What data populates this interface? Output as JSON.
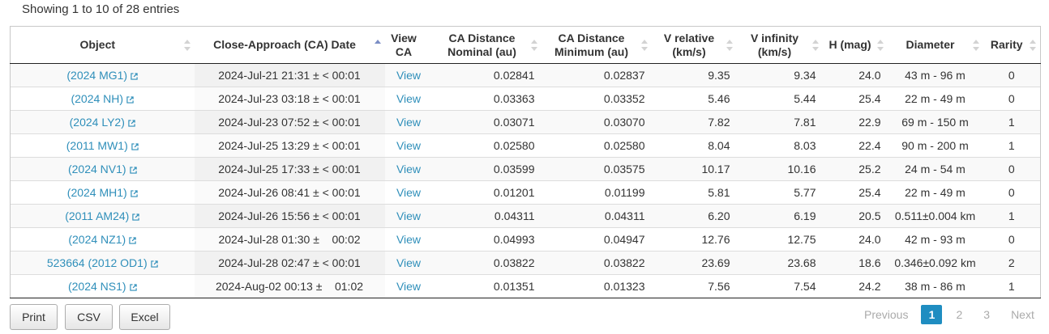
{
  "table_info": "Showing 1 to 10 of 28 entries",
  "columns": [
    {
      "label": "Object",
      "sort": "both"
    },
    {
      "label": "Close-Approach (CA) Date",
      "sort": "asc"
    },
    {
      "label": "View CA",
      "sort": "none"
    },
    {
      "label": "CA Distance Nominal (au)",
      "sort": "both"
    },
    {
      "label": "CA Distance Minimum (au)",
      "sort": "both"
    },
    {
      "label": "V relative (km/s)",
      "sort": "both"
    },
    {
      "label": "V infinity (km/s)",
      "sort": "both"
    },
    {
      "label": "H (mag)",
      "sort": "both"
    },
    {
      "label": "Diameter",
      "sort": "both"
    },
    {
      "label": "Rarity",
      "sort": "both"
    }
  ],
  "rows": [
    {
      "object": "(2024 MG1)",
      "date": "2024-Jul-21 21:31 ± < 00:01",
      "view": "View",
      "dist_nom": "0.02841",
      "dist_min": "0.02837",
      "v_rel": "9.35",
      "v_inf": "9.34",
      "h": "24.0",
      "diameter": "43 m - 96 m",
      "rarity": "0"
    },
    {
      "object": "(2024 NH)",
      "date": "2024-Jul-23 03:18 ± < 00:01",
      "view": "View",
      "dist_nom": "0.03363",
      "dist_min": "0.03352",
      "v_rel": "5.46",
      "v_inf": "5.44",
      "h": "25.4",
      "diameter": "22 m - 49 m",
      "rarity": "0"
    },
    {
      "object": "(2024 LY2)",
      "date": "2024-Jul-23 07:52 ± < 00:01",
      "view": "View",
      "dist_nom": "0.03071",
      "dist_min": "0.03070",
      "v_rel": "7.82",
      "v_inf": "7.81",
      "h": "22.9",
      "diameter": "69 m - 150 m",
      "rarity": "1"
    },
    {
      "object": "(2011 MW1)",
      "date": "2024-Jul-25 13:29 ± < 00:01",
      "view": "View",
      "dist_nom": "0.02580",
      "dist_min": "0.02580",
      "v_rel": "8.04",
      "v_inf": "8.03",
      "h": "22.4",
      "diameter": "90 m - 200 m",
      "rarity": "1"
    },
    {
      "object": "(2024 NV1)",
      "date": "2024-Jul-25 17:33 ± < 00:01",
      "view": "View",
      "dist_nom": "0.03599",
      "dist_min": "0.03575",
      "v_rel": "10.17",
      "v_inf": "10.16",
      "h": "25.2",
      "diameter": "24 m - 54 m",
      "rarity": "0"
    },
    {
      "object": "(2024 MH1)",
      "date": "2024-Jul-26 08:41 ± < 00:01",
      "view": "View",
      "dist_nom": "0.01201",
      "dist_min": "0.01199",
      "v_rel": "5.81",
      "v_inf": "5.77",
      "h": "25.4",
      "diameter": "22 m - 49 m",
      "rarity": "0"
    },
    {
      "object": "(2011 AM24)",
      "date": "2024-Jul-26 15:56 ± < 00:01",
      "view": "View",
      "dist_nom": "0.04311",
      "dist_min": "0.04311",
      "v_rel": "6.20",
      "v_inf": "6.19",
      "h": "20.5",
      "diameter": "0.511±0.004 km",
      "rarity": "1"
    },
    {
      "object": "(2024 NZ1)",
      "date": "2024-Jul-28 01:30 ±    00:02",
      "view": "View",
      "dist_nom": "0.04993",
      "dist_min": "0.04947",
      "v_rel": "12.76",
      "v_inf": "12.75",
      "h": "24.0",
      "diameter": "42 m - 93 m",
      "rarity": "0"
    },
    {
      "object": "523664 (2012 OD1)",
      "date": "2024-Jul-28 02:47 ± < 00:01",
      "view": "View",
      "dist_nom": "0.03822",
      "dist_min": "0.03822",
      "v_rel": "23.69",
      "v_inf": "23.68",
      "h": "18.6",
      "diameter": "0.346±0.092 km",
      "rarity": "2"
    },
    {
      "object": "(2024 NS1)",
      "date": "2024-Aug-02 00:13 ±    01:02",
      "view": "View",
      "dist_nom": "0.01351",
      "dist_min": "0.01323",
      "v_rel": "7.56",
      "v_inf": "7.54",
      "h": "24.2",
      "diameter": "38 m - 86 m",
      "rarity": "1"
    }
  ],
  "buttons": {
    "print": "Print",
    "csv": "CSV",
    "excel": "Excel"
  },
  "pagination": {
    "previous": "Previous",
    "pages": [
      "1",
      "2",
      "3"
    ],
    "current": "1",
    "next": "Next"
  },
  "colors": {
    "link": "#2f8fba",
    "active_page": "#1f8dc1",
    "sort_active": "#7b8ec5"
  }
}
